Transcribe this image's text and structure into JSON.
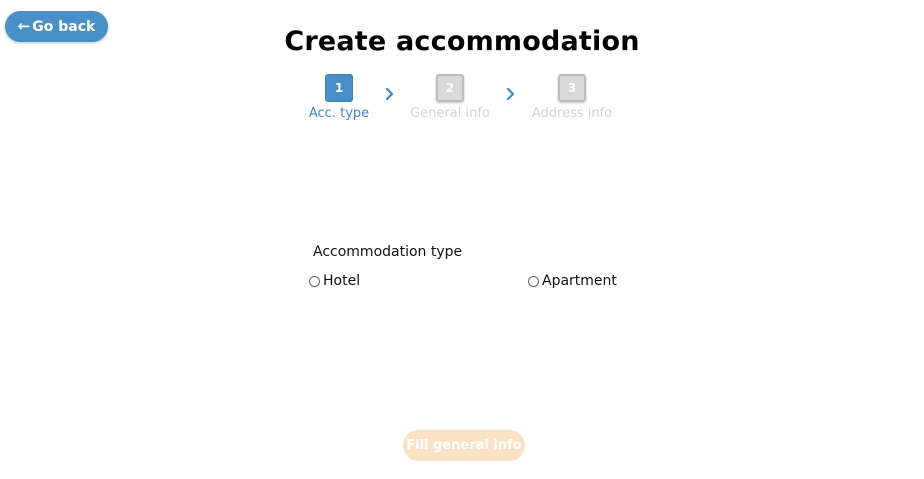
{
  "header": {
    "back_label": "Go back",
    "back_icon": "arrow-left-icon",
    "title": "Create accommodation"
  },
  "stepper": {
    "steps": [
      {
        "number": "1",
        "label": "Acc. type",
        "state": "active"
      },
      {
        "number": "2",
        "label": "General info",
        "state": "inactive"
      },
      {
        "number": "3",
        "label": "Address info",
        "state": "inactive"
      }
    ],
    "separator_icon": "chevron-right-icon"
  },
  "form": {
    "field_label": "Accommodation type",
    "options": [
      {
        "label": "Hotel",
        "selected": false
      },
      {
        "label": "Apartment",
        "selected": false
      }
    ]
  },
  "footer": {
    "submit_label": "Fill general info",
    "submit_disabled": true
  },
  "colors": {
    "primary": "#4a90c8",
    "active_step_text": "#3c86c6",
    "inactive_step_box": "#d9d9d9",
    "inactive_step_text": "#d3d3d3",
    "disabled_button": "#f8e2c3"
  }
}
